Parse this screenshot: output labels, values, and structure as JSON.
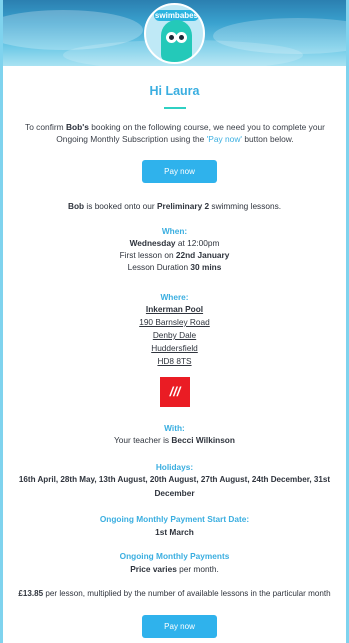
{
  "brand": {
    "name": "swimbabes"
  },
  "greeting": "Hi Laura",
  "intro": {
    "p1": "To confirm ",
    "child": "Bob's",
    "p2": " booking on the following course, we need you to complete your Ongoing Monthly Subscription using the ",
    "cta": "'Pay now'",
    "p3": " button below."
  },
  "pay_now_label": "Pay now",
  "booking": {
    "child": "Bob",
    "t1": " is booked onto our ",
    "course": "Preliminary 2",
    "t2": " swimming lessons."
  },
  "when": {
    "label": "When:",
    "day": "Wednesday",
    "at": " at 12:00pm",
    "first_prefix": "First lesson on ",
    "first_date": "22nd January",
    "duration_prefix": "Lesson Duration ",
    "duration": "30 mins"
  },
  "where": {
    "label": "Where:",
    "venue": "Inkerman Pool",
    "addr1": "190 Barnsley Road",
    "addr2": "Denby Dale",
    "addr3": "Huddersfield",
    "postcode": "HD8 8TS"
  },
  "with": {
    "label": "With:",
    "prefix": "Your teacher is ",
    "teacher": "Becci Wilkinson"
  },
  "holidays": {
    "label": "Holidays:",
    "line1": "16th April, 28th May, 13th August, 20th August, 27th August, 24th December, 31st",
    "line2": "December"
  },
  "start": {
    "label": "Ongoing Monthly Payment Start Date:",
    "date": "1st March"
  },
  "payments": {
    "label": "Ongoing Monthly Payments",
    "price": "Price varies",
    "suffix": " per month."
  },
  "per_lesson": {
    "amount": "£13.85",
    "rest": " per lesson, multiplied by the number of available lessons in the particular month"
  },
  "colors": {
    "accent": "#3aaee0",
    "button": "#2fb2ec",
    "teal": "#2fd0c3",
    "venue_logo": "#ea1c24"
  }
}
